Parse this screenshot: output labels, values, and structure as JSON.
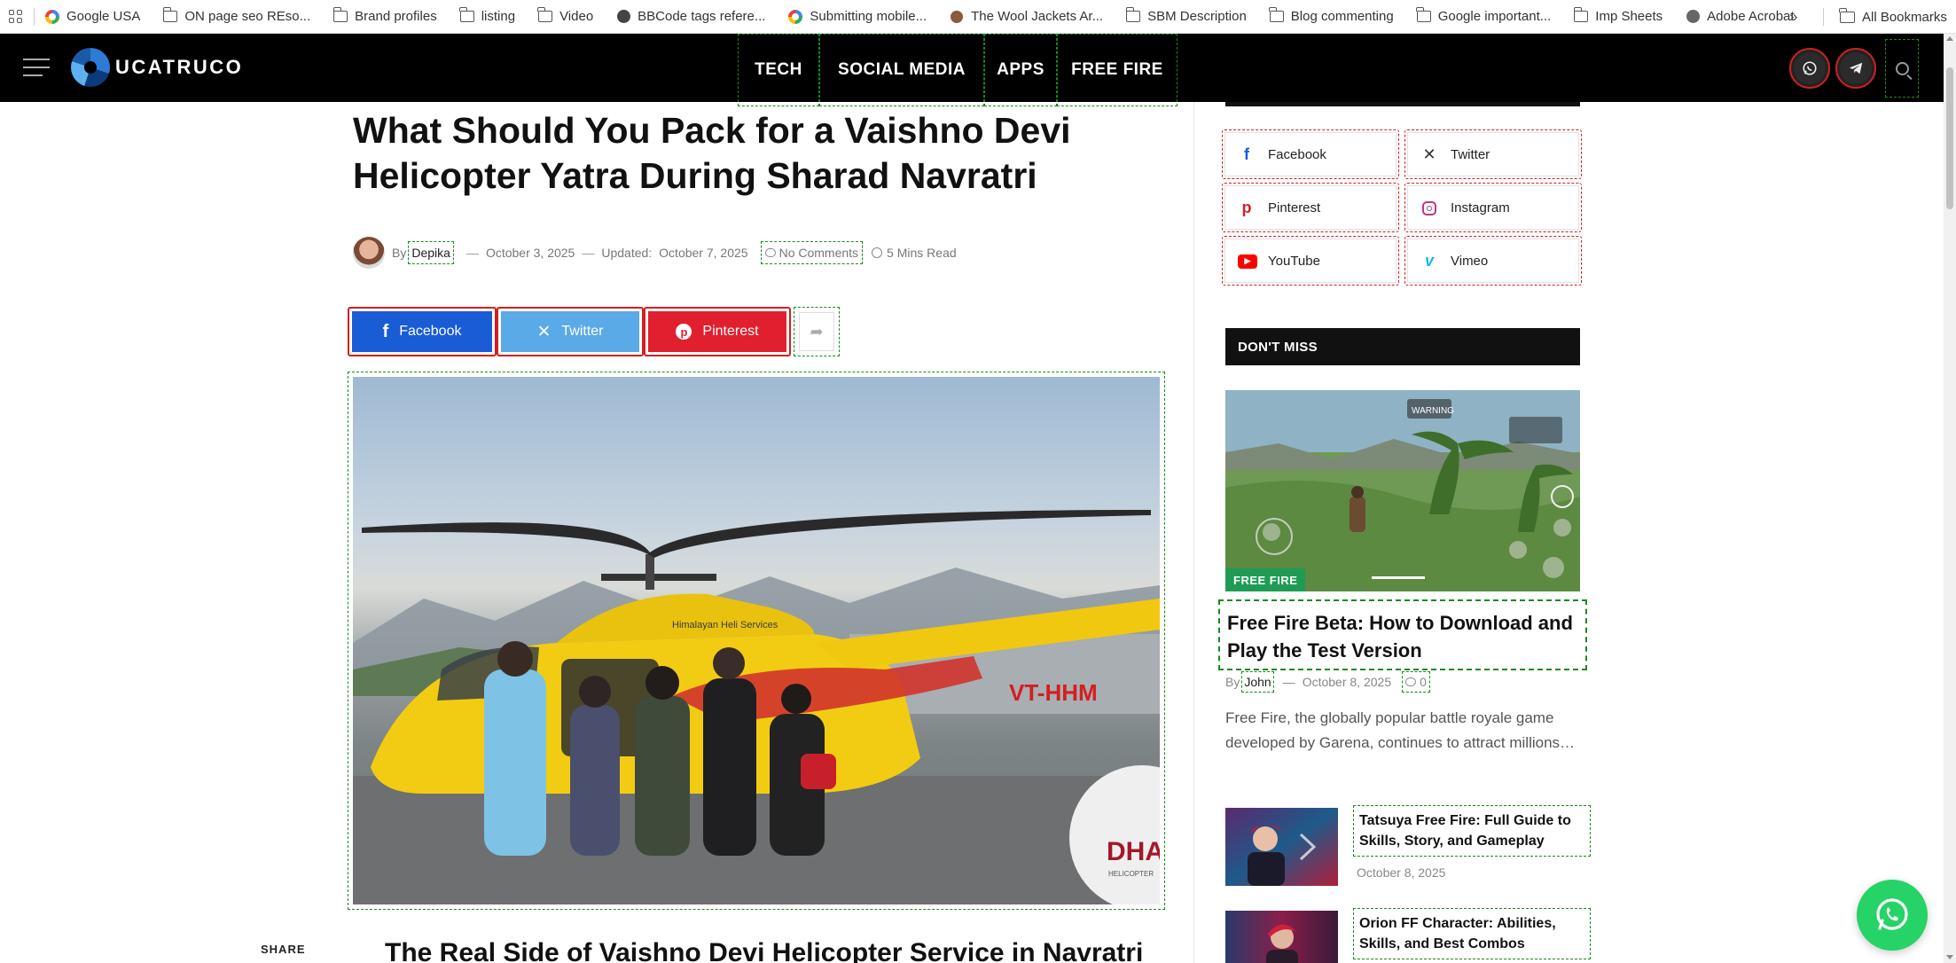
{
  "bookmarks": {
    "items": [
      {
        "label": "Google USA",
        "icon": "google-icon"
      },
      {
        "label": "ON page seo REso...",
        "icon": "folder-icon"
      },
      {
        "label": "Brand profiles",
        "icon": "folder-icon"
      },
      {
        "label": "listing",
        "icon": "folder-icon"
      },
      {
        "label": "Video",
        "icon": "folder-icon"
      },
      {
        "label": "BBCode tags refere...",
        "icon": "globe-icon"
      },
      {
        "label": "Submitting mobile...",
        "icon": "google-icon"
      },
      {
        "label": "The Wool Jackets Ar...",
        "icon": "feather-icon"
      },
      {
        "label": "SBM Description",
        "icon": "folder-icon"
      },
      {
        "label": "Blog commenting",
        "icon": "folder-icon"
      },
      {
        "label": "Google important...",
        "icon": "folder-icon"
      },
      {
        "label": "Imp Sheets",
        "icon": "folder-icon"
      },
      {
        "label": "Adobe Acrobat",
        "icon": "acrobat-icon"
      }
    ],
    "more": "»",
    "all_bookmarks": "All Bookmarks"
  },
  "header": {
    "logo_text": "UCATRUCO",
    "nav": [
      "TECH",
      "SOCIAL MEDIA",
      "APPS",
      "FREE FIRE"
    ]
  },
  "article": {
    "title": "What Should You Pack for a Vaishno Devi Helicopter Yatra During Sharad Navratri",
    "by": "By",
    "author": "Depika",
    "date": "October 3, 2025",
    "updated_label": "Updated:",
    "updated_date": "October 7, 2025",
    "comments": "No Comments",
    "read_time": "5 Mins Read",
    "share_buttons": [
      {
        "label": "Facebook",
        "color": "#1a5bd6"
      },
      {
        "label": "Twitter",
        "color": "#5aaae8"
      },
      {
        "label": "Pinterest",
        "color": "#e01f2f"
      }
    ],
    "hero_text": {
      "heli_brand": "Himalayan Heli Services",
      "tail": "VT-HHM",
      "logo_partial": "DHA",
      "logo_sub": "HELICOPTER"
    },
    "share_label": "SHARE",
    "subheading": "The Real Side of Vaishno Devi Helicopter Service in Navratri"
  },
  "sidebar": {
    "social": [
      {
        "label": "Facebook",
        "icon": "facebook-icon",
        "color": "#1a5bd6"
      },
      {
        "label": "Twitter",
        "icon": "x-icon",
        "color": "#333333"
      },
      {
        "label": "Pinterest",
        "icon": "pinterest-icon",
        "color": "#d21f2f"
      },
      {
        "label": "Instagram",
        "icon": "instagram-icon",
        "color": "#c13584"
      },
      {
        "label": "YouTube",
        "icon": "youtube-icon",
        "color": "#ff0000"
      },
      {
        "label": "Vimeo",
        "icon": "vimeo-icon",
        "color": "#1ab7ea"
      }
    ],
    "dont_miss": "DON'T MISS",
    "featured": {
      "category": "FREE FIRE",
      "title": "Free Fire Beta: How to Download and Play the Test Version",
      "by": "By",
      "author": "John",
      "date": "October 8, 2025",
      "comments": "0",
      "excerpt": "Free Fire, the globally popular battle royale game developed by Garena, continues to attract millions…",
      "game_warning": "WARNING"
    },
    "posts": [
      {
        "title": "Tatsuya Free Fire: Full Guide to Skills, Story, and Gameplay",
        "date": "October 8, 2025"
      },
      {
        "title": "Orion FF Character: Abilities, Skills, and Best Combos",
        "date": ""
      }
    ]
  }
}
